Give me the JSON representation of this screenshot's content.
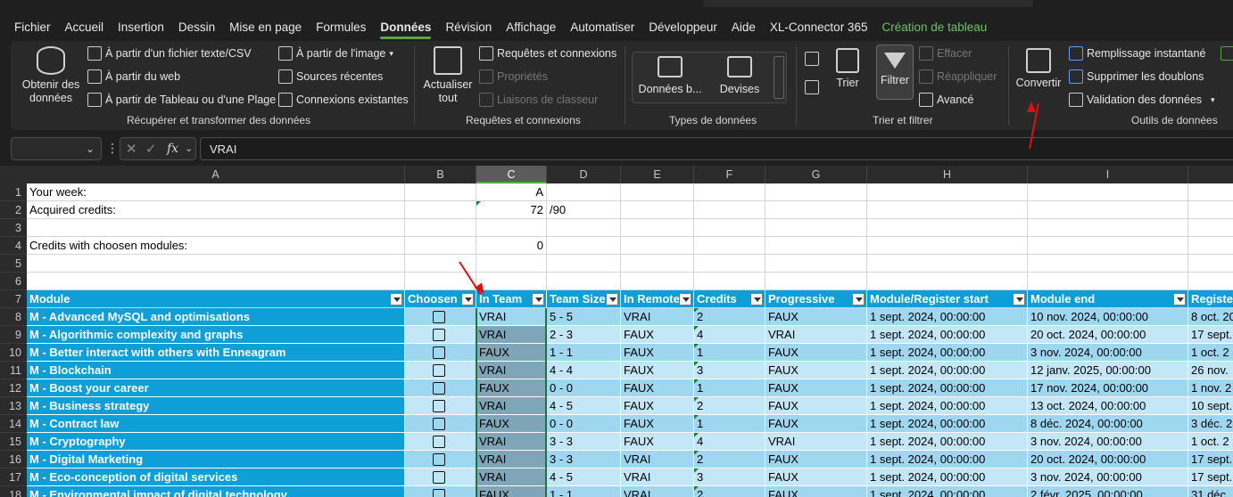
{
  "menu": [
    "Fichier",
    "Accueil",
    "Insertion",
    "Dessin",
    "Mise en page",
    "Formules",
    "Données",
    "Révision",
    "Affichage",
    "Automatiser",
    "Développeur",
    "Aide",
    "XL-Connector 365",
    "Création de tableau"
  ],
  "ribbon": {
    "get_data": "Obtenir des données",
    "from_text": "À partir d'un fichier texte/CSV",
    "from_web": "À partir du web",
    "from_table": "À partir de Tableau ou d'une Plage",
    "from_image": "À partir de l'image",
    "recent_sources": "Sources récentes",
    "existing_conn": "Connexions existantes",
    "grp_get": "Récupérer et transformer des données",
    "refresh_all": "Actualiser tout",
    "queries": "Requêtes et connexions",
    "properties": "Propriétés",
    "workbook_links": "Liaisons de classeur",
    "grp_queries": "Requêtes et connexions",
    "stocks": "Données b...",
    "currencies": "Devises",
    "grp_types": "Types de données",
    "sort": "Trier",
    "filter": "Filtrer",
    "clear": "Effacer",
    "reapply": "Réappliquer",
    "advanced": "Avancé",
    "grp_sort": "Trier et filtrer",
    "convert": "Convertir",
    "flash_fill": "Remplissage instantané",
    "remove_dup": "Supprimer les doublons",
    "validation": "Validation des données",
    "grp_tools": "Outils de données"
  },
  "formula": {
    "value": "VRAI"
  },
  "columns": [
    "A",
    "B",
    "C",
    "D",
    "E",
    "F",
    "G",
    "H",
    "I"
  ],
  "rows_top": [
    {
      "n": "1",
      "a": "Your week:",
      "c": "A",
      "d": ""
    },
    {
      "n": "2",
      "a": "Acquired credits:",
      "c": "72",
      "d": "/90"
    },
    {
      "n": "3",
      "a": "",
      "c": "",
      "d": ""
    },
    {
      "n": "4",
      "a": "Credits with choosen modules:",
      "c": "0",
      "d": ""
    },
    {
      "n": "5",
      "a": "",
      "c": "",
      "d": ""
    },
    {
      "n": "6",
      "a": "",
      "c": "",
      "d": ""
    }
  ],
  "table_header": {
    "n": "7",
    "cols": [
      "Module",
      "Choosen",
      "In Team",
      "Team Size",
      "In Remote",
      "Credits",
      "Progressive",
      "Module/Register start",
      "Module end",
      "Registe"
    ]
  },
  "table_rows": [
    {
      "n": "8",
      "module": "M - Advanced MySQL and optimisations",
      "team": "VRAI",
      "size": "5 - 5",
      "remote": "VRAI",
      "credits": "2",
      "prog": "FAUX",
      "start": "1 sept. 2024, 00:00:00",
      "end": "10 nov. 2024, 00:00:00",
      "reg": "8 oct. 20"
    },
    {
      "n": "9",
      "module": "M - Algorithmic complexity and graphs",
      "team": "VRAI",
      "size": "2 - 3",
      "remote": "FAUX",
      "credits": "4",
      "prog": "VRAI",
      "start": "1 sept. 2024, 00:00:00",
      "end": "20 oct. 2024, 00:00:00",
      "reg": "17 sept."
    },
    {
      "n": "10",
      "module": "M - Better interact with others with Enneagram",
      "team": "FAUX",
      "size": "1 - 1",
      "remote": "FAUX",
      "credits": "1",
      "prog": "FAUX",
      "start": "1 sept. 2024, 00:00:00",
      "end": "3 nov. 2024, 00:00:00",
      "reg": "1 oct. 2"
    },
    {
      "n": "11",
      "module": "M - Blockchain",
      "team": "VRAI",
      "size": "4 - 4",
      "remote": "FAUX",
      "credits": "3",
      "prog": "FAUX",
      "start": "1 sept. 2024, 00:00:00",
      "end": "12 janv. 2025, 00:00:00",
      "reg": "26 nov."
    },
    {
      "n": "12",
      "module": "M - Boost your career",
      "team": "FAUX",
      "size": "0 - 0",
      "remote": "FAUX",
      "credits": "1",
      "prog": "FAUX",
      "start": "1 sept. 2024, 00:00:00",
      "end": "17 nov. 2024, 00:00:00",
      "reg": "1 nov. 2"
    },
    {
      "n": "13",
      "module": "M - Business strategy",
      "team": "VRAI",
      "size": "4 - 5",
      "remote": "FAUX",
      "credits": "2",
      "prog": "FAUX",
      "start": "1 sept. 2024, 00:00:00",
      "end": "13 oct. 2024, 00:00:00",
      "reg": "10 sept."
    },
    {
      "n": "14",
      "module": "M - Contract law",
      "team": "FAUX",
      "size": "0 - 0",
      "remote": "FAUX",
      "credits": "1",
      "prog": "FAUX",
      "start": "1 sept. 2024, 00:00:00",
      "end": "8 déc. 2024, 00:00:00",
      "reg": "3 déc. 2"
    },
    {
      "n": "15",
      "module": "M - Cryptography",
      "team": "VRAI",
      "size": "3 - 3",
      "remote": "FAUX",
      "credits": "4",
      "prog": "VRAI",
      "start": "1 sept. 2024, 00:00:00",
      "end": "3 nov. 2024, 00:00:00",
      "reg": "1 oct. 2"
    },
    {
      "n": "16",
      "module": "M - Digital Marketing",
      "team": "VRAI",
      "size": "3 - 3",
      "remote": "VRAI",
      "credits": "2",
      "prog": "FAUX",
      "start": "1 sept. 2024, 00:00:00",
      "end": "20 oct. 2024, 00:00:00",
      "reg": "17 sept."
    },
    {
      "n": "17",
      "module": "M - Eco-conception of digital services",
      "team": "VRAI",
      "size": "4 - 5",
      "remote": "VRAI",
      "credits": "3",
      "prog": "FAUX",
      "start": "1 sept. 2024, 00:00:00",
      "end": "3 nov. 2024, 00:00:00",
      "reg": "17 sept."
    },
    {
      "n": "18",
      "module": "M - Environmental impact of digital technology",
      "team": "FAUX",
      "size": "1 - 1",
      "remote": "VRAI",
      "credits": "2",
      "prog": "FAUX",
      "start": "1 sept. 2024, 00:00:00",
      "end": "2 févr. 2025, 00:00:00",
      "reg": "31 déc."
    }
  ]
}
